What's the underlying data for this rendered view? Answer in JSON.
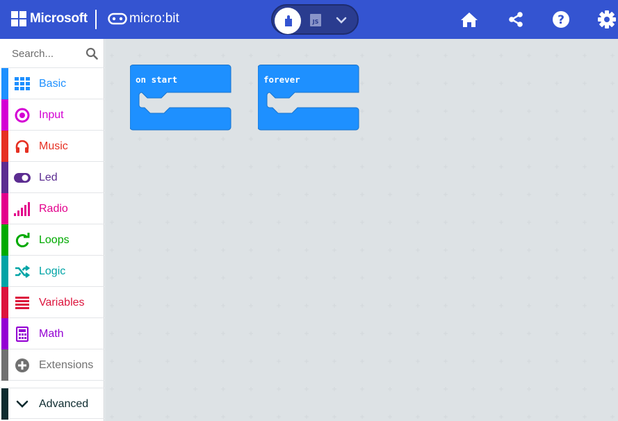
{
  "header": {
    "brand": "Microsoft",
    "product": "micro:bit",
    "toggle": {
      "blocks_icon": "puzzle-icon",
      "js_label": "JS",
      "dropdown_icon": "chevron-down-icon"
    },
    "actions": [
      {
        "name": "home-icon"
      },
      {
        "name": "share-icon"
      },
      {
        "name": "help-icon"
      },
      {
        "name": "gear-icon"
      }
    ],
    "background": "#3454d1"
  },
  "sidebar": {
    "search_placeholder": "Search...",
    "categories": [
      {
        "label": "Basic",
        "color": "#1e90ff",
        "icon": "grid-icon"
      },
      {
        "label": "Input",
        "color": "#d400d4",
        "icon": "target-icon"
      },
      {
        "label": "Music",
        "color": "#e63022",
        "icon": "headphones-icon"
      },
      {
        "label": "Led",
        "color": "#5c2d91",
        "icon": "toggle-icon"
      },
      {
        "label": "Radio",
        "color": "#e3008c",
        "icon": "signal-bars-icon"
      },
      {
        "label": "Loops",
        "color": "#00aa00",
        "icon": "refresh-icon"
      },
      {
        "label": "Logic",
        "color": "#00a4a6",
        "icon": "shuffle-icon"
      },
      {
        "label": "Variables",
        "color": "#dc143c",
        "icon": "list-lines-icon"
      },
      {
        "label": "Math",
        "color": "#9400d3",
        "icon": "calculator-icon"
      },
      {
        "label": "Extensions",
        "color": "#717171",
        "icon": "plus-circle-icon"
      }
    ],
    "advanced": {
      "label": "Advanced",
      "color": "#0d2b2f",
      "icon": "chevron-down-icon"
    }
  },
  "workspace": {
    "blocks": [
      {
        "label": "on start",
        "color": "#1e90ff"
      },
      {
        "label": "forever",
        "color": "#1e90ff"
      }
    ]
  }
}
